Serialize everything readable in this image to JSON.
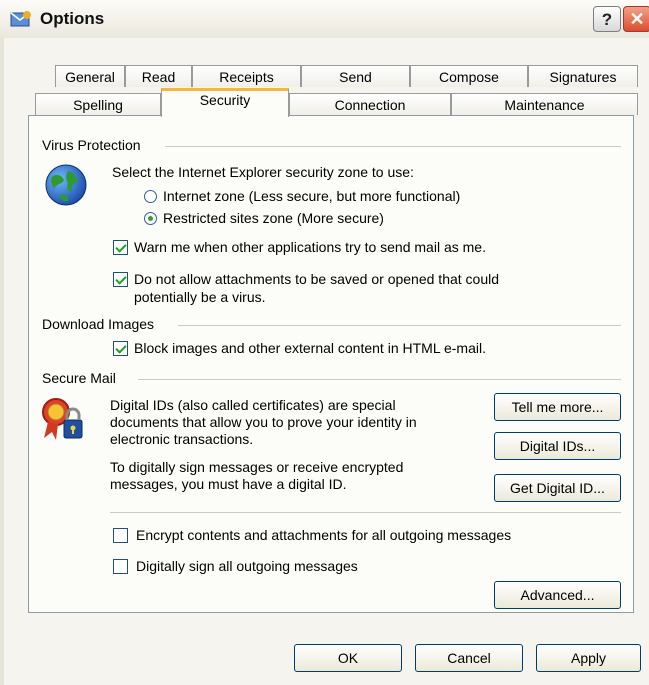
{
  "window": {
    "title": "Options",
    "help_label": "?",
    "close_label": "✕"
  },
  "tabs_row1": [
    "General",
    "Read",
    "Receipts",
    "Send",
    "Compose",
    "Signatures"
  ],
  "tabs_row2": [
    "Spelling",
    "Security",
    "Connection",
    "Maintenance"
  ],
  "active_tab": "Security",
  "virus_protection": {
    "heading": "Virus Protection",
    "zone_prompt": "Select the Internet Explorer security zone to use:",
    "zones": [
      {
        "label": "Internet zone (Less secure, but more functional)",
        "selected": false
      },
      {
        "label": "Restricted sites zone (More secure)",
        "selected": true
      }
    ],
    "warn_label": "Warn me when other applications try to send mail as me.",
    "warn_checked": true,
    "attachments_label_line1": "Do not allow attachments to be saved or opened that could",
    "attachments_label_line2": "potentially be a virus.",
    "attachments_checked": true
  },
  "download_images": {
    "heading": "Download Images",
    "block_label": "Block images and other external content in HTML e-mail.",
    "block_checked": true
  },
  "secure_mail": {
    "heading": "Secure Mail",
    "desc1_lines": [
      "Digital IDs (also called certificates) are special",
      "documents that allow you to prove your identity in",
      "electronic transactions."
    ],
    "desc2_lines": [
      "To digitally sign messages or receive encrypted",
      "messages, you must have a digital ID."
    ],
    "tell_me_more": "Tell me more...",
    "digital_ids": "Digital IDs...",
    "get_digital_id": "Get Digital ID...",
    "encrypt_label": "Encrypt contents and attachments for all outgoing messages",
    "encrypt_checked": false,
    "sign_label": "Digitally sign all outgoing messages",
    "sign_checked": false,
    "advanced": "Advanced..."
  },
  "footer": {
    "ok": "OK",
    "cancel": "Cancel",
    "apply": "Apply"
  }
}
